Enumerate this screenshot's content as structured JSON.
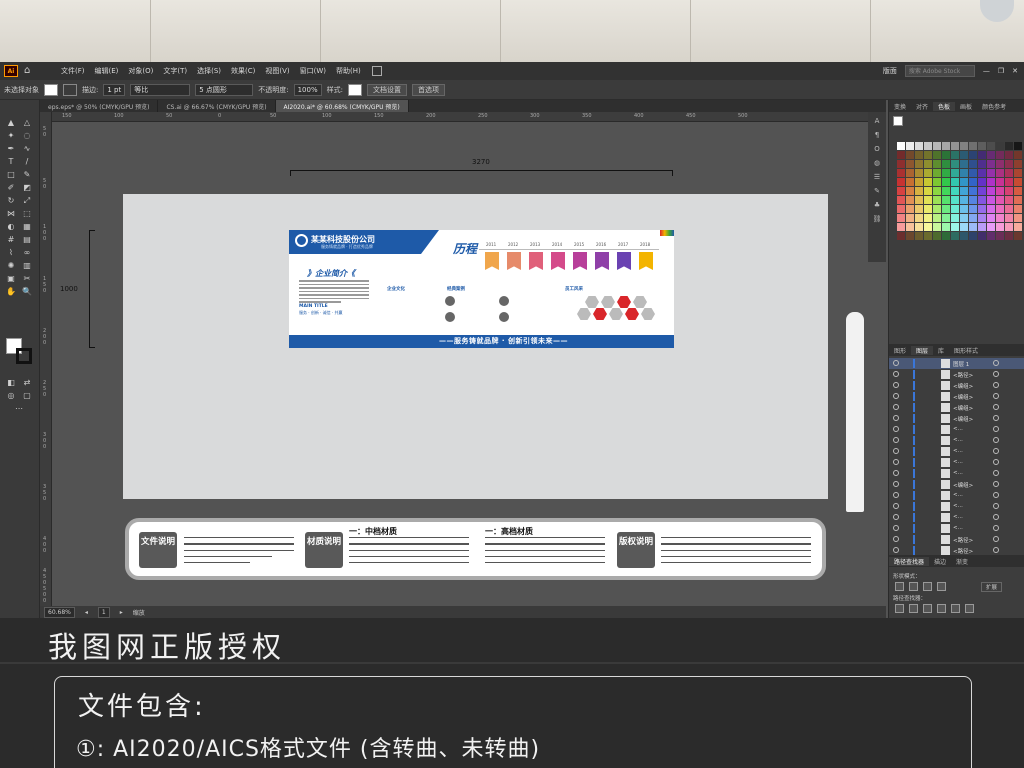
{
  "menubar": {
    "app_badge": "Ai",
    "items": [
      "文件(F)",
      "编辑(E)",
      "对象(O)",
      "文字(T)",
      "选择(S)",
      "效果(C)",
      "视图(V)",
      "窗口(W)",
      "帮助(H)"
    ],
    "workspace": "版面",
    "stock_placeholder": "搜索 Adobe Stock"
  },
  "controlbar": {
    "selection": "未选择对象",
    "stroke_label": "描边:",
    "stroke_value": "1 pt",
    "brush_label": "等比",
    "point_label": "5 点圆形",
    "opacity_label": "不透明度:",
    "opacity_value": "100%",
    "style_label": "样式:",
    "doc_setup": "文档设置",
    "prefs": "首选项"
  },
  "tabs": [
    {
      "label": "eps.eps* @ 50% (CMYK/GPU 预览)"
    },
    {
      "label": "CS.ai @ 66.67% (CMYK/GPU 预览)"
    },
    {
      "label": "AI2020.ai* @ 60.68% (CMYK/GPU 预览)"
    }
  ],
  "ruler": {
    "h_ticks": [
      "150",
      "100",
      "50",
      "0",
      "50",
      "100",
      "150",
      "200",
      "250",
      "300",
      "350",
      "400",
      "450",
      "500"
    ],
    "v_ticks": [
      "5",
      "0",
      "5",
      "0",
      "1",
      "0",
      "0",
      "1",
      "5",
      "0",
      "2",
      "0",
      "0",
      "2",
      "5",
      "0",
      "3",
      "0",
      "0",
      "3",
      "5",
      "0",
      "4",
      "0",
      "0",
      "4",
      "5",
      "0",
      "5",
      "0",
      "0",
      "5",
      "5",
      "0"
    ]
  },
  "canvas": {
    "width_label": "3270",
    "height_label": "1000"
  },
  "wall": {
    "company": "某某科技股份公司",
    "slogan": "服务铸就品牌 · 打造优秀品牌",
    "intro_title": "》企业简介《",
    "main_title": "MAIN TITLE",
    "main_sub": "服务 · 创新 · 诚信 · 共赢",
    "history_title": "历程",
    "years": [
      "2011",
      "2012",
      "2013",
      "2014",
      "2015",
      "2016",
      "2017",
      "2018"
    ],
    "culture_title": "企业文化",
    "cases_title": "经典案例",
    "staff_title": "员工风采",
    "bottom_slogan": "——服务铸就品牌 · 创新引领未来——"
  },
  "notes": {
    "file_label": "文件说明",
    "material_label": "材质说明",
    "mid_title": "一：中档材质",
    "high_title": "一：高档材质",
    "copyright_label": "版权说明"
  },
  "statusbar": {
    "zoom": "60.68%",
    "page": "1",
    "mode": "缩放"
  },
  "right_panel": {
    "top_tabs": [
      "变换",
      "对齐",
      "色板",
      "画板",
      "颜色参考"
    ],
    "layer_tabs": [
      "图形",
      "图层",
      "库",
      "图形样式"
    ],
    "layers": [
      "图层 1",
      "<路径>",
      "<编组>",
      "<编组>",
      "<编组>",
      "<编组>",
      "<...",
      "<...",
      "<...",
      "<...",
      "<...",
      "<编组>",
      "<...",
      "<...",
      "<...",
      "<...",
      "<路径>",
      "<路径>",
      "<路径>"
    ],
    "pf_tabs": [
      "路径查找器",
      "描边",
      "渐变"
    ],
    "shape_mode": "形状模式：",
    "pathfinder_label": "路径查找器：",
    "expand": "扩展"
  },
  "promo": {
    "heading": "我图网正版授权",
    "contains": "文件包含:",
    "item": "①: AI2020/AICS格式文件 (含转曲、未转曲)"
  },
  "colors": {
    "accent_blue": "#1e5aa8",
    "accent_red": "#d9262a",
    "ai_orange": "#ff9a00"
  }
}
